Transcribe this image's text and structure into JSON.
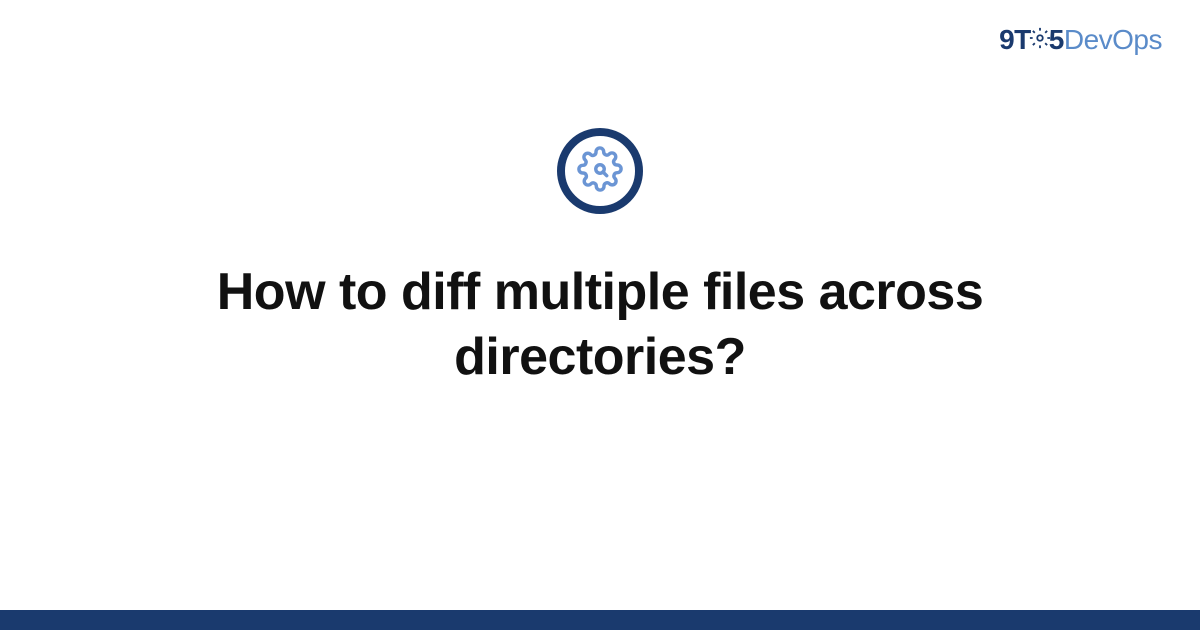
{
  "logo": {
    "part1": "9T",
    "part2": "5",
    "part3": "Dev",
    "part4": "Ops"
  },
  "title": "How to diff multiple files across directories?",
  "icons": {
    "logo_gear": "gear-icon",
    "center_gear": "gear-icon"
  },
  "colors": {
    "brand_dark": "#1a3a6e",
    "brand_light": "#5a8bc9",
    "text": "#111111"
  }
}
